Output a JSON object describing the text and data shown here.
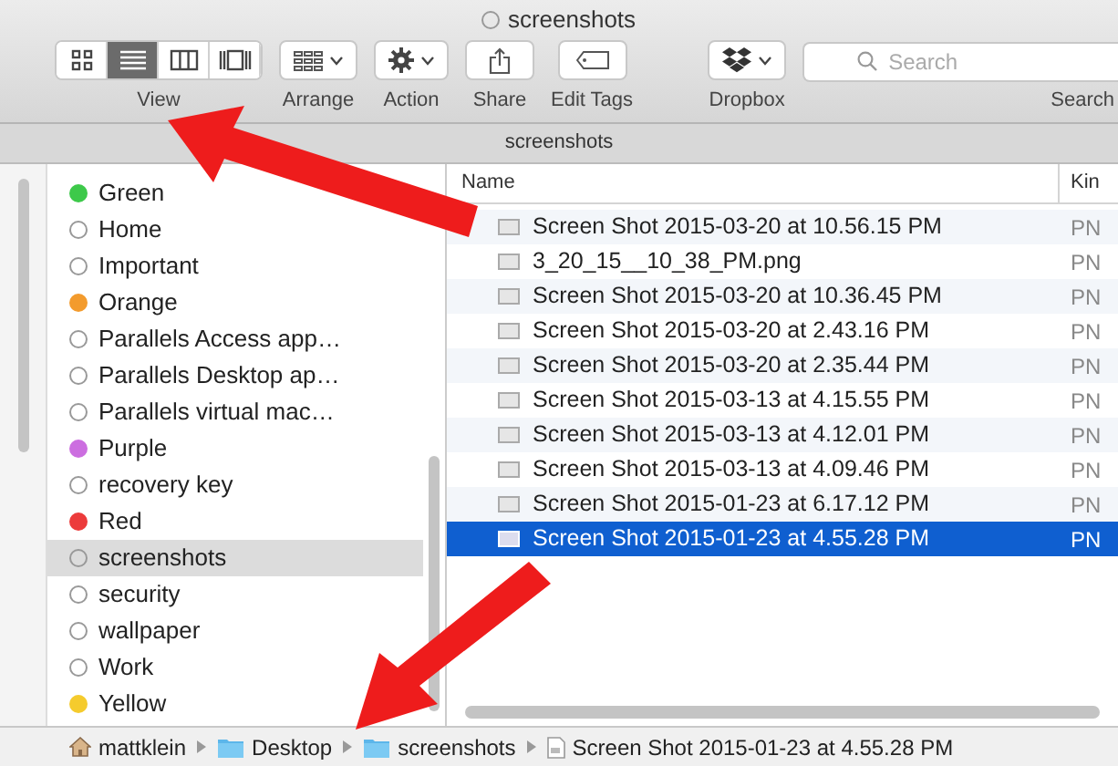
{
  "window": {
    "title": "screenshots"
  },
  "toolbar": {
    "view_modes": [
      {
        "kind": "icons",
        "selected": false
      },
      {
        "kind": "list",
        "selected": true
      },
      {
        "kind": "columns",
        "selected": false
      },
      {
        "kind": "coverflow",
        "selected": false
      }
    ],
    "view_label": "View",
    "buttons": [
      {
        "kind": "arrange",
        "label": "Arrange"
      },
      {
        "kind": "action",
        "label": "Action"
      },
      {
        "kind": "share",
        "label": "Share"
      },
      {
        "kind": "tags",
        "label": "Edit Tags"
      },
      {
        "kind": "dropbox",
        "label": "Dropbox"
      }
    ],
    "search": {
      "placeholder": "Search",
      "label": "Search"
    }
  },
  "path_header": "screenshots",
  "sidebar": {
    "items": [
      {
        "label": "Green",
        "color": "#3dc94a",
        "selected": false
      },
      {
        "label": "Home",
        "selected": false
      },
      {
        "label": "Important",
        "selected": false
      },
      {
        "label": "Orange",
        "color": "#f39b2d",
        "selected": false
      },
      {
        "label": "Parallels Access app…",
        "selected": false
      },
      {
        "label": "Parallels Desktop ap…",
        "selected": false
      },
      {
        "label": "Parallels virtual mac…",
        "selected": false
      },
      {
        "label": "Purple",
        "color": "#cc6ee0",
        "selected": false
      },
      {
        "label": "recovery key",
        "selected": false
      },
      {
        "label": "Red",
        "color": "#ec3b3b",
        "selected": false
      },
      {
        "label": "screenshots",
        "selected": true
      },
      {
        "label": "security",
        "selected": false
      },
      {
        "label": "wallpaper",
        "selected": false
      },
      {
        "label": "Work",
        "selected": false
      },
      {
        "label": "Yellow",
        "color": "#f5cb2d",
        "selected": false
      }
    ]
  },
  "table": {
    "columns": [
      "Name",
      "Kin"
    ],
    "rows": [
      {
        "name": "Screen Shot 2015-03-20 at 10.56.15 PM",
        "kind": "PN",
        "selected": false
      },
      {
        "name": "3_20_15__10_38_PM.png",
        "kind": "PN",
        "selected": false
      },
      {
        "name": "Screen Shot 2015-03-20 at 10.36.45 PM",
        "kind": "PN",
        "selected": false
      },
      {
        "name": "Screen Shot 2015-03-20 at 2.43.16 PM",
        "kind": "PN",
        "selected": false
      },
      {
        "name": "Screen Shot 2015-03-20 at 2.35.44 PM",
        "kind": "PN",
        "selected": false
      },
      {
        "name": "Screen Shot 2015-03-13 at 4.15.55 PM",
        "kind": "PN",
        "selected": false
      },
      {
        "name": "Screen Shot 2015-03-13 at 4.12.01 PM",
        "kind": "PN",
        "selected": false
      },
      {
        "name": "Screen Shot 2015-03-13 at 4.09.46 PM",
        "kind": "PN",
        "selected": false
      },
      {
        "name": "Screen Shot 2015-01-23 at 6.17.12 PM",
        "kind": "PN",
        "selected": false
      },
      {
        "name": "Screen Shot 2015-01-23 at 4.55.28 PM",
        "kind": "PN",
        "selected": true
      }
    ]
  },
  "path_bar": [
    {
      "kind": "home",
      "label": "mattklein"
    },
    {
      "kind": "folder",
      "label": "Desktop"
    },
    {
      "kind": "folder",
      "label": "screenshots"
    },
    {
      "kind": "file",
      "label": "Screen Shot 2015-01-23 at 4.55.28 PM"
    }
  ]
}
